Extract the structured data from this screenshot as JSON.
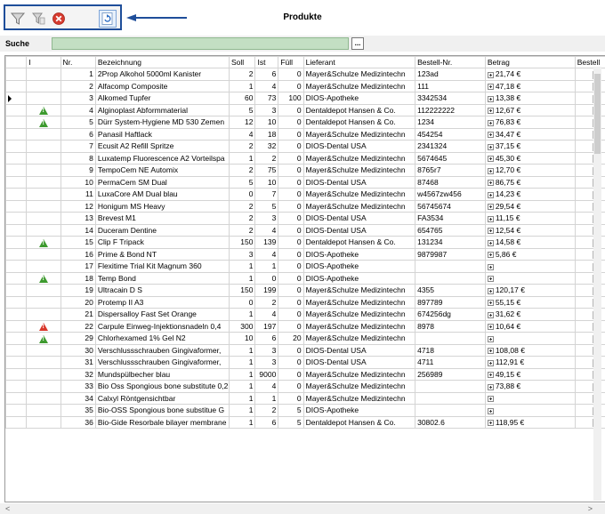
{
  "window": {
    "title": "Produkte"
  },
  "toolbar": {
    "buttons": [
      {
        "name": "filter-icon",
        "icon": "filter"
      },
      {
        "name": "clear-filter-icon",
        "icon": "filter-clear"
      },
      {
        "name": "delete-icon",
        "icon": "red-x"
      },
      {
        "name": "refresh-icon",
        "icon": "refresh"
      }
    ]
  },
  "search": {
    "label": "Suche",
    "value": "",
    "button_label": "..."
  },
  "table": {
    "columns": [
      "I",
      "Nr.",
      "Bezeichnung",
      "Soll",
      "Ist",
      "Füll",
      "Lieferant",
      "Bestell-Nr.",
      "Betrag",
      "Bestell"
    ],
    "rows": [
      {
        "nr": "1",
        "bez": "2Prop Alkohol 5000ml Kanister",
        "soll": "2",
        "ist": "6",
        "fuell": "0",
        "lief": "Mayer&Schulze Medizintechn",
        "bnr": "123ad",
        "betrag": "21,74 €",
        "check": false,
        "warn": ""
      },
      {
        "nr": "2",
        "bez": "Alfacomp Composite",
        "soll": "1",
        "ist": "4",
        "fuell": "0",
        "lief": "Mayer&Schulze Medizintechn",
        "bnr": "111",
        "betrag": "47,18 €",
        "check": false,
        "warn": ""
      },
      {
        "nr": "3",
        "bez": "Alkomed Tupfer",
        "soll": "60",
        "ist": "73",
        "fuell": "100",
        "lief": "DIOS-Apotheke",
        "bnr": "3342534",
        "betrag": "13,38 €",
        "check": true,
        "warn": "",
        "current": true
      },
      {
        "nr": "4",
        "bez": "Alginoplast Abformmaterial",
        "soll": "5",
        "ist": "3",
        "fuell": "0",
        "lief": "Dentaldepot Hansen & Co.",
        "bnr": "112222222",
        "betrag": "12,67 €",
        "check": true,
        "warn": "green"
      },
      {
        "nr": "5",
        "bez": "Dürr System-Hygiene MD 530 Zemen",
        "soll": "12",
        "ist": "10",
        "fuell": "0",
        "lief": "Dentaldepot Hansen & Co.",
        "bnr": "1234",
        "betrag": "76,83 €",
        "check": true,
        "warn": "green"
      },
      {
        "nr": "6",
        "bez": "Panasil Haftlack",
        "soll": "4",
        "ist": "18",
        "fuell": "0",
        "lief": "Mayer&Schulze Medizintechn",
        "bnr": "454254",
        "betrag": "34,47 €",
        "check": false,
        "warn": ""
      },
      {
        "nr": "7",
        "bez": "Ecusit A2 Refill Spritze",
        "soll": "2",
        "ist": "32",
        "fuell": "0",
        "lief": "DIOS-Dental USA",
        "bnr": "2341324",
        "betrag": "37,15 €",
        "check": false,
        "warn": ""
      },
      {
        "nr": "8",
        "bez": "Luxatemp Fluorescence A2 Vorteilspa",
        "soll": "1",
        "ist": "2",
        "fuell": "0",
        "lief": "Mayer&Schulze Medizintechn",
        "bnr": "5674645",
        "betrag": "45,30 €",
        "check": false,
        "warn": ""
      },
      {
        "nr": "9",
        "bez": "TempoCem NE Automix",
        "soll": "2",
        "ist": "75",
        "fuell": "0",
        "lief": "Mayer&Schulze Medizintechn",
        "bnr": "8765r7",
        "betrag": "12,70 €",
        "check": false,
        "warn": ""
      },
      {
        "nr": "10",
        "bez": "PermaCem SM Dual",
        "soll": "5",
        "ist": "10",
        "fuell": "0",
        "lief": "DIOS-Dental USA",
        "bnr": "87468",
        "betrag": "86,75 €",
        "check": false,
        "warn": ""
      },
      {
        "nr": "11",
        "bez": "LuxaCore AM Dual blau",
        "soll": "0",
        "ist": "7",
        "fuell": "0",
        "lief": "Mayer&Schulze Medizintechn",
        "bnr": "w4567zw456",
        "betrag": "14,23 €",
        "check": false,
        "warn": ""
      },
      {
        "nr": "12",
        "bez": "Honigum MS Heavy",
        "soll": "2",
        "ist": "5",
        "fuell": "0",
        "lief": "Mayer&Schulze Medizintechn",
        "bnr": "56745674",
        "betrag": "29,54 €",
        "check": false,
        "warn": ""
      },
      {
        "nr": "13",
        "bez": "Brevest  M1",
        "soll": "2",
        "ist": "3",
        "fuell": "0",
        "lief": "DIOS-Dental USA",
        "bnr": "FA3534",
        "betrag": "11,15 €",
        "check": false,
        "warn": ""
      },
      {
        "nr": "14",
        "bez": "Duceram Dentine",
        "soll": "2",
        "ist": "4",
        "fuell": "0",
        "lief": "DIOS-Dental USA",
        "bnr": "654765",
        "betrag": "12,54 €",
        "check": false,
        "warn": ""
      },
      {
        "nr": "15",
        "bez": "Clip F Tripack",
        "soll": "150",
        "ist": "139",
        "fuell": "0",
        "lief": "Dentaldepot Hansen & Co.",
        "bnr": "131234",
        "betrag": "14,58 €",
        "check": true,
        "warn": "green"
      },
      {
        "nr": "16",
        "bez": "Prime & Bond NT",
        "soll": "3",
        "ist": "4",
        "fuell": "0",
        "lief": "DIOS-Apotheke",
        "bnr": "9879987",
        "betrag": "5,86 €",
        "check": false,
        "warn": ""
      },
      {
        "nr": "17",
        "bez": "Flexitime Trial Kit Magnum 360",
        "soll": "1",
        "ist": "1",
        "fuell": "0",
        "lief": "DIOS-Apotheke",
        "bnr": "",
        "betrag": "",
        "check": false,
        "warn": ""
      },
      {
        "nr": "18",
        "bez": "Temp Bond",
        "soll": "1",
        "ist": "0",
        "fuell": "0",
        "lief": "DIOS-Apotheke",
        "bnr": "",
        "betrag": "",
        "check": true,
        "warn": "green"
      },
      {
        "nr": "19",
        "bez": "Ultracain D S",
        "soll": "150",
        "ist": "199",
        "fuell": "0",
        "lief": "Mayer&Schulze Medizintechn",
        "bnr": "4355",
        "betrag": "120,17 €",
        "check": false,
        "warn": ""
      },
      {
        "nr": "20",
        "bez": "Protemp II A3",
        "soll": "0",
        "ist": "2",
        "fuell": "0",
        "lief": "Mayer&Schulze Medizintechn",
        "bnr": "897789",
        "betrag": "55,15 €",
        "check": false,
        "warn": ""
      },
      {
        "nr": "21",
        "bez": "Dispersalloy Fast Set Orange",
        "soll": "1",
        "ist": "4",
        "fuell": "0",
        "lief": "Mayer&Schulze Medizintechn",
        "bnr": "674256dg",
        "betrag": "31,62 €",
        "check": false,
        "warn": ""
      },
      {
        "nr": "22",
        "bez": "Carpule Einweg-Injektionsnadeln 0,4",
        "soll": "300",
        "ist": "197",
        "fuell": "0",
        "lief": "Mayer&Schulze Medizintechn",
        "bnr": "8978",
        "betrag": "10,64 €",
        "check": false,
        "warn": "red"
      },
      {
        "nr": "29",
        "bez": "Chlorhexamed 1% Gel N2",
        "soll": "10",
        "ist": "6",
        "fuell": "20",
        "lief": "Mayer&Schulze Medizintechn",
        "bnr": "",
        "betrag": "",
        "check": true,
        "warn": "green"
      },
      {
        "nr": "30",
        "bez": "Verschlussschrauben Gingivaformer,",
        "soll": "1",
        "ist": "3",
        "fuell": "0",
        "lief": "DIOS-Dental USA",
        "bnr": "4718",
        "betrag": "108,08 €",
        "check": false,
        "warn": ""
      },
      {
        "nr": "31",
        "bez": "Verschlussschrauben Gingivaformer,",
        "soll": "1",
        "ist": "3",
        "fuell": "0",
        "lief": "DIOS-Dental USA",
        "bnr": "4711",
        "betrag": "112,91 €",
        "check": false,
        "warn": ""
      },
      {
        "nr": "32",
        "bez": "Mundspülbecher blau",
        "soll": "1",
        "ist": "9000",
        "fuell": "0",
        "lief": "Mayer&Schulze Medizintechn",
        "bnr": "256989",
        "betrag": "49,15 €",
        "check": false,
        "warn": ""
      },
      {
        "nr": "33",
        "bez": "Bio Oss Spongious bone substitute 0,2",
        "soll": "1",
        "ist": "4",
        "fuell": "0",
        "lief": "Mayer&Schulze Medizintechn",
        "bnr": "",
        "betrag": "73,88 €",
        "check": false,
        "warn": ""
      },
      {
        "nr": "34",
        "bez": "Calxyl Röntgensichtbar",
        "soll": "1",
        "ist": "1",
        "fuell": "0",
        "lief": "Mayer&Schulze Medizintechn",
        "bnr": "",
        "betrag": "",
        "check": false,
        "warn": ""
      },
      {
        "nr": "35",
        "bez": "Bio-OSS Spongious bone substitue G",
        "soll": "1",
        "ist": "2",
        "fuell": "5",
        "lief": "DIOS-Apotheke",
        "bnr": "",
        "betrag": "",
        "check": true,
        "warn": ""
      },
      {
        "nr": "36",
        "bez": "Bio-Gide Resorbale bilayer membrane",
        "soll": "1",
        "ist": "6",
        "fuell": "5",
        "lief": "Dentaldepot Hansen & Co.",
        "bnr": "30802.6",
        "betrag": "118,95 €",
        "check": false,
        "warn": ""
      }
    ]
  },
  "colors": {
    "toolbar_border": "#1f4e9a",
    "arrow": "#1f4e9a",
    "search_bg": "#c3dfc3",
    "warn_green": "#3d9a2e",
    "warn_red": "#d9372b"
  },
  "scroll": {
    "left_glyph": "<",
    "right_glyph": ">"
  }
}
